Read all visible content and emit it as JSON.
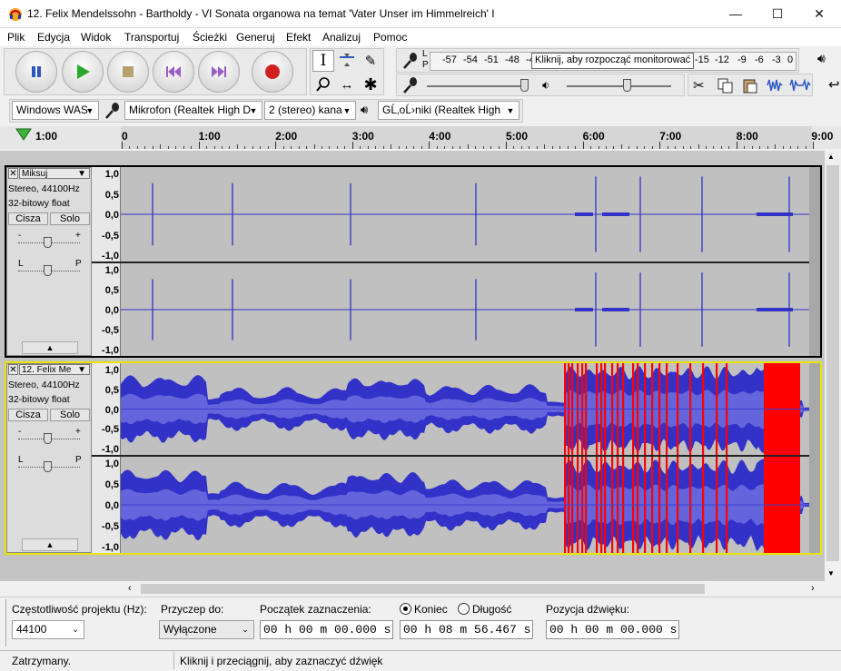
{
  "window": {
    "title": "12. Felix Mendelssohn - Bartholdy - VI Sonata organowa na temat 'Vater Unser im Himmelreich' I",
    "minimize_glyph": "—",
    "maximize_glyph": "☐",
    "close_glyph": "✕"
  },
  "menu": [
    "Plik",
    "Edycja",
    "Widok",
    "Transportuj",
    "Ścieżki",
    "Generuj",
    "Efekt",
    "Analizuj",
    "Pomoc"
  ],
  "meter": {
    "rec_letter_l": "L",
    "rec_letter_p": "P",
    "scale": [
      "-57",
      "-54",
      "-51",
      "-48",
      "-45"
    ],
    "monitor_label": "Kliknij, aby rozpocząć monitorować",
    "scale_right": [
      "-15",
      "-12",
      "-9",
      "-6",
      "-3",
      "0"
    ]
  },
  "devices": {
    "host": "Windows WAS",
    "mic": "Mikrofon (Realtek High D",
    "channels": "2 (stereo) kana",
    "speaker": "GĹ‚oĹ›niki (Realtek High"
  },
  "ruler": {
    "start_label": "1:00",
    "ticks": [
      "0",
      "1:00",
      "2:00",
      "3:00",
      "4:00",
      "5:00",
      "6:00",
      "7:00",
      "8:00",
      "9:00"
    ]
  },
  "tracks": [
    {
      "name": "Miksuj",
      "rate": "Stereo, 44100Hz",
      "format": "32-bitowy float",
      "mute": "Cisza",
      "solo": "Solo",
      "gain_minus": "-",
      "gain_plus": "+",
      "pan_l": "L",
      "pan_p": "P"
    },
    {
      "name": "12. Felix Me",
      "rate": "Stereo, 44100Hz",
      "format": "32-bitowy float",
      "mute": "Cisza",
      "solo": "Solo",
      "gain_minus": "-",
      "gain_plus": "+",
      "pan_l": "L",
      "pan_p": "P"
    }
  ],
  "scale_labels": [
    "1,0",
    "0,5",
    "0,0",
    "-0,5",
    "-1,0"
  ],
  "bottom": {
    "rate_label": "Częstotliwość projektu (Hz):",
    "rate_value": "44100",
    "snap_label": "Przyczep do:",
    "snap_value": "Wyłączone",
    "sel_start_label": "Początek zaznaczenia:",
    "sel_start_value": "00 h 00 m 00.000 s",
    "end_label": "Koniec",
    "length_label": "Długość",
    "end_value": "00 h 08 m 56.467 s",
    "pos_label": "Pozycja dźwięku:",
    "pos_value": "00 h 00 m 00.000 s"
  },
  "status": {
    "left": "Zatrzymany.",
    "right": "Kliknij i przeciągnij, aby zaznaczyć dźwięk"
  },
  "colors": {
    "waveform": "#3232c8",
    "clip": "#ff0000",
    "selected_track_border": "#e6e600"
  }
}
